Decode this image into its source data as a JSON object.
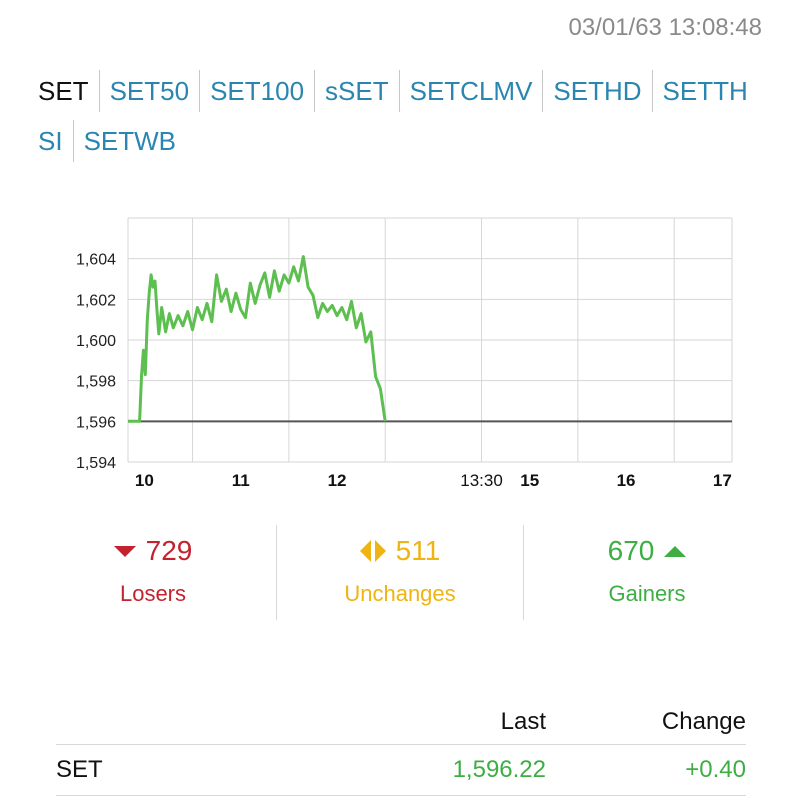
{
  "timestamp": "03/01/63 13:08:48",
  "tabs": [
    {
      "label": "SET",
      "active": true
    },
    {
      "label": "SET50",
      "active": false
    },
    {
      "label": "SET100",
      "active": false
    },
    {
      "label": "sSET",
      "active": false
    },
    {
      "label": "SETCLMV",
      "active": false
    },
    {
      "label": "SETHD",
      "active": false
    },
    {
      "label": "SETTH",
      "active": false
    },
    {
      "label": "SI",
      "active": false
    },
    {
      "label": "SETWB",
      "active": false
    }
  ],
  "chart_data": {
    "type": "line",
    "x_ticks": [
      {
        "t": 10,
        "label": "10"
      },
      {
        "t": 11,
        "label": "11"
      },
      {
        "t": 12,
        "label": "12"
      },
      {
        "t": 13.5,
        "label": "13:30"
      },
      {
        "t": 14,
        "label": "15"
      },
      {
        "t": 15,
        "label": "16"
      },
      {
        "t": 16,
        "label": "17"
      }
    ],
    "xlim": [
      9.83,
      16.1
    ],
    "ylim": [
      1594,
      1606
    ],
    "y_ticks": [
      1594,
      1596,
      1598,
      1600,
      1602,
      1604
    ],
    "y_tick_labels": [
      "1,594",
      "1,596",
      "1,598",
      "1,600",
      "1,602",
      "1,604"
    ],
    "baseline": 1596,
    "grid": true,
    "series": [
      {
        "color": "#5cbf4f",
        "x": [
          9.83,
          9.95,
          9.97,
          9.99,
          10.01,
          10.03,
          10.05,
          10.07,
          10.09,
          10.11,
          10.13,
          10.15,
          10.18,
          10.22,
          10.26,
          10.3,
          10.35,
          10.4,
          10.45,
          10.5,
          10.55,
          10.6,
          10.65,
          10.7,
          10.75,
          10.8,
          10.85,
          10.9,
          10.95,
          11.0,
          11.05,
          11.1,
          11.15,
          11.2,
          11.25,
          11.3,
          11.35,
          11.4,
          11.45,
          11.5,
          11.55,
          11.6,
          11.65,
          11.7,
          11.75,
          11.8,
          11.85,
          11.9,
          11.95,
          12.0,
          12.05,
          12.1,
          12.15,
          12.2,
          12.25,
          12.3,
          12.35,
          12.4,
          12.45,
          12.5
        ],
        "y": [
          1596.0,
          1596.0,
          1598.2,
          1599.5,
          1598.3,
          1601.0,
          1602.3,
          1603.2,
          1602.6,
          1602.9,
          1601.5,
          1600.3,
          1601.6,
          1600.4,
          1601.3,
          1600.6,
          1601.2,
          1600.7,
          1601.4,
          1600.5,
          1601.6,
          1601.0,
          1601.8,
          1600.9,
          1603.2,
          1601.9,
          1602.5,
          1601.4,
          1602.3,
          1601.5,
          1601.1,
          1602.8,
          1601.8,
          1602.7,
          1603.3,
          1602.1,
          1603.4,
          1602.4,
          1603.2,
          1602.8,
          1603.6,
          1602.9,
          1604.1,
          1602.6,
          1602.2,
          1601.1,
          1601.8,
          1601.4,
          1601.7,
          1601.2,
          1601.6,
          1601.0,
          1601.9,
          1600.6,
          1601.3,
          1599.9,
          1600.4,
          1598.2,
          1597.6,
          1596.0
        ]
      }
    ]
  },
  "stats": {
    "losers": {
      "count": "729",
      "label": "Losers",
      "icon": "triangle-down-icon",
      "color": "#c3232e"
    },
    "unchanged": {
      "count": "511",
      "label": "Unchanges",
      "icon": "left-right-arrows-icon",
      "color": "#efb412"
    },
    "gainers": {
      "count": "670",
      "label": "Gainers",
      "icon": "triangle-up-icon",
      "color": "#3eae44"
    }
  },
  "table": {
    "headers": {
      "last": "Last",
      "change": "Change"
    },
    "rows": [
      {
        "name": "SET",
        "last": "1,596.22",
        "change": "+0.40"
      }
    ]
  }
}
